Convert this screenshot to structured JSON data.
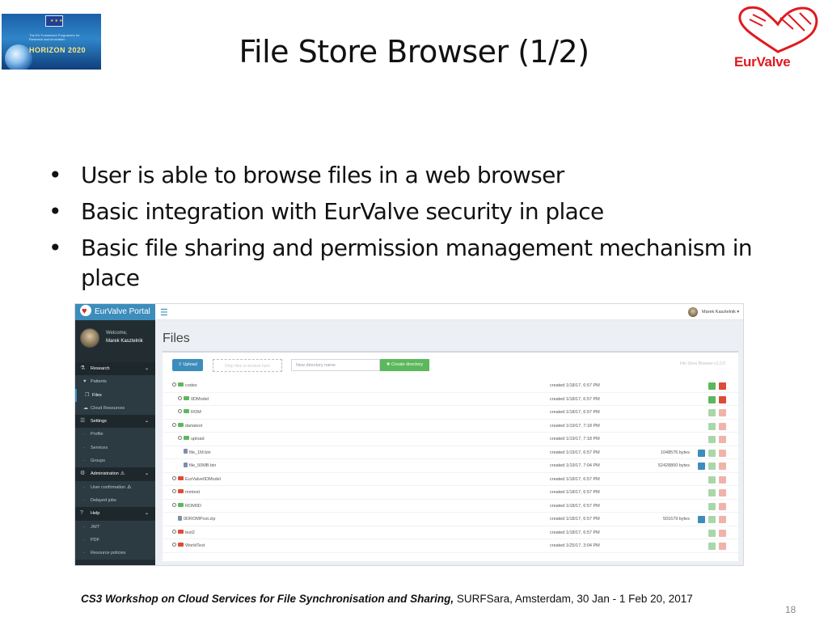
{
  "slide": {
    "title": "File Store Browser (1/2)",
    "horizon_logo_text": "HORIZON 2020",
    "horizon_logo_subtext": "The EU Framework Programme for Research and Innovation",
    "eurvalve_logo_text": "EurValve",
    "bullets": [
      "User is able to browse files in a web browser",
      "Basic integration with EurValve security in place",
      "Basic file sharing and permission management mechanism in place"
    ],
    "footer_bold": "CS3 Workshop on Cloud Services for File Synchronisation and Sharing,",
    "footer_rest": " SURFSara,  Amsterdam, 30 Jan - 1 Feb 20, 2017",
    "page_number": "18"
  },
  "portal": {
    "brand": "EurValve Portal",
    "welcome": "Welcome,",
    "user_name": "Marek Kasztelnik",
    "top_user": "Marek Kasztelnik ▾",
    "menu": [
      {
        "label": "Research",
        "type": "head",
        "icon": "flask-icon",
        "glyph": "⚗",
        "chevron": "⌄"
      },
      {
        "label": "Patients",
        "type": "sub",
        "icon": "heart-icon",
        "glyph": "♥"
      },
      {
        "label": "Files",
        "type": "sub active",
        "icon": "files-icon",
        "glyph": "❐"
      },
      {
        "label": "Cloud Resources",
        "type": "sub",
        "icon": "cloud-icon",
        "glyph": "☁"
      },
      {
        "label": "Settings",
        "type": "head",
        "icon": "sliders-icon",
        "glyph": "☰",
        "chevron": "⌄"
      },
      {
        "label": "Profile",
        "type": "sub",
        "icon": "dot-icon",
        "glyph": "·"
      },
      {
        "label": "Services",
        "type": "sub",
        "icon": "dot-icon",
        "glyph": "·"
      },
      {
        "label": "Groups",
        "type": "sub",
        "icon": "dot-icon",
        "glyph": "·"
      },
      {
        "label": "Administration",
        "type": "head",
        "icon": "cogs-icon",
        "glyph": "⚙",
        "chevron": "⌄",
        "warn": "⚠"
      },
      {
        "label": "User confirmation",
        "type": "sub",
        "icon": "dot-icon",
        "glyph": "·",
        "warn": "⚠"
      },
      {
        "label": "Delayed jobs",
        "type": "sub",
        "icon": "dot-icon",
        "glyph": "·"
      },
      {
        "label": "Help",
        "type": "head",
        "icon": "question-icon",
        "glyph": "?",
        "chevron": "⌄"
      },
      {
        "label": "JWT",
        "type": "sub",
        "icon": "dot-icon",
        "glyph": "·"
      },
      {
        "label": "PDF",
        "type": "sub",
        "icon": "dot-icon",
        "glyph": "·"
      },
      {
        "label": "Resource policies",
        "type": "sub",
        "icon": "dot-icon",
        "glyph": "·"
      }
    ],
    "page_title": "Files",
    "upload_label": "Upload",
    "drop_zone_text": "Drop files or browse here",
    "directory_placeholder": "New directory name",
    "create_directory_label": "Create directory",
    "store_note": "File Store Browser v1.0.0",
    "files": [
      {
        "name": "codes",
        "kind": "folder",
        "indent": 0,
        "created": "created 1/18/17, 6:57 PM",
        "size": "",
        "download": false,
        "muted": false
      },
      {
        "name": "0DModel",
        "kind": "folder",
        "indent": 1,
        "created": "created 1/18/17, 6:57 PM",
        "size": "",
        "download": false,
        "muted": false
      },
      {
        "name": "ROM",
        "kind": "folder",
        "indent": 1,
        "created": "created 1/18/17, 6:57 PM",
        "size": "",
        "download": false,
        "muted": true
      },
      {
        "name": "dariatest",
        "kind": "folder",
        "indent": 0,
        "created": "created 1/19/17, 7:18 PM",
        "size": "",
        "download": false,
        "muted": true
      },
      {
        "name": "upload",
        "kind": "folder",
        "indent": 1,
        "created": "created 1/19/17, 7:18 PM",
        "size": "",
        "download": false,
        "muted": true
      },
      {
        "name": "file_1M.bin",
        "kind": "file",
        "indent": 2,
        "created": "created 1/19/17, 6:57 PM",
        "size": "1048576 bytes",
        "download": true,
        "muted": true
      },
      {
        "name": "file_50MB.bin",
        "kind": "file",
        "indent": 2,
        "created": "created 1/19/17, 7:04 PM",
        "size": "52428800 bytes",
        "download": true,
        "muted": true
      },
      {
        "name": "EurValve0DModel",
        "kind": "folder-red",
        "indent": 0,
        "created": "created 1/18/17, 6:57 PM",
        "size": "",
        "download": false,
        "muted": true
      },
      {
        "name": "mmtest",
        "kind": "folder-red",
        "indent": 0,
        "created": "created 1/18/17, 6:57 PM",
        "size": "",
        "download": false,
        "muted": true
      },
      {
        "name": "ROM0D",
        "kind": "folder",
        "indent": 0,
        "created": "created 1/18/17, 6:57 PM",
        "size": "",
        "download": false,
        "muted": true
      },
      {
        "name": "0DROMPost.zip",
        "kind": "file",
        "indent": 1,
        "created": "created 1/18/17, 6:57 PM",
        "size": "501679 bytes",
        "download": true,
        "muted": true
      },
      {
        "name": "test2",
        "kind": "folder-red",
        "indent": 0,
        "created": "created 1/18/17, 6:57 PM",
        "size": "",
        "download": false,
        "muted": true
      },
      {
        "name": "WorldTest",
        "kind": "folder-red",
        "indent": 0,
        "created": "created 1/25/17, 3:04 PM",
        "size": "",
        "download": false,
        "muted": true
      }
    ]
  }
}
